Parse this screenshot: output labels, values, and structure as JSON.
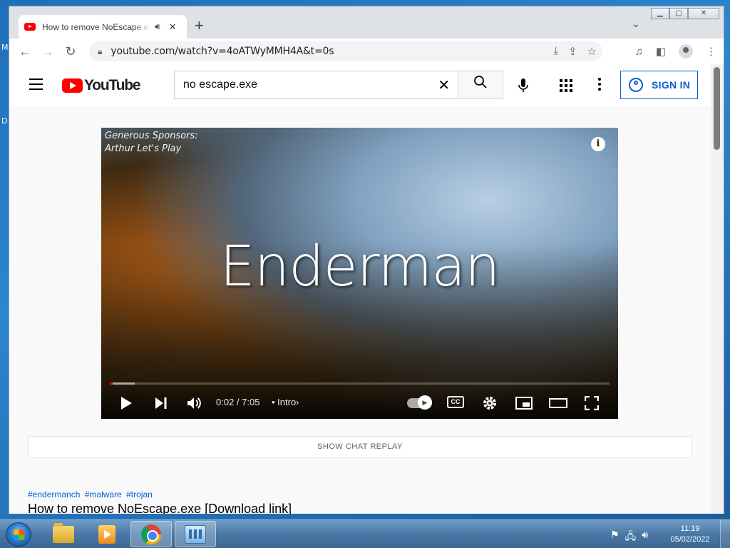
{
  "desktop": {
    "edge_letters": [
      "M",
      "D"
    ]
  },
  "browser": {
    "tab_title": "How to remove NoEscape.exe [Download link]",
    "url": "youtube.com/watch?v=4oATWyMMH4A&t=0s",
    "new_tab_symbol": "+",
    "tab_search_symbol": "⌄"
  },
  "youtube": {
    "logo_text": "YouTube",
    "search_query": "no escape.exe",
    "sign_in_label": "SIGN IN",
    "player": {
      "overlay_line1": "Generous Sponsors:",
      "overlay_line2": "Arthur Let's Play",
      "video_text": "Enderman",
      "time": "0:02 / 7:05",
      "chapter": "• Intro",
      "progress_fraction": 0.005,
      "buffered_fraction": 0.05,
      "autoplay": "on"
    },
    "chat_replay_label": "SHOW CHAT REPLAY",
    "hashtags": [
      "#endermanch",
      "#malware",
      "#trojan"
    ],
    "video_title": "How to remove NoEscape.exe [Download link]"
  },
  "taskbar": {
    "apps": [
      "explorer-icon",
      "media-player-icon",
      "chrome-icon",
      "control-panel-icon"
    ],
    "time": "11:19",
    "date": "05/02/2022"
  },
  "colors": {
    "youtube_red": "#ff0000",
    "link_blue": "#065fd4",
    "taskbar_blue": "#4a78a6"
  }
}
